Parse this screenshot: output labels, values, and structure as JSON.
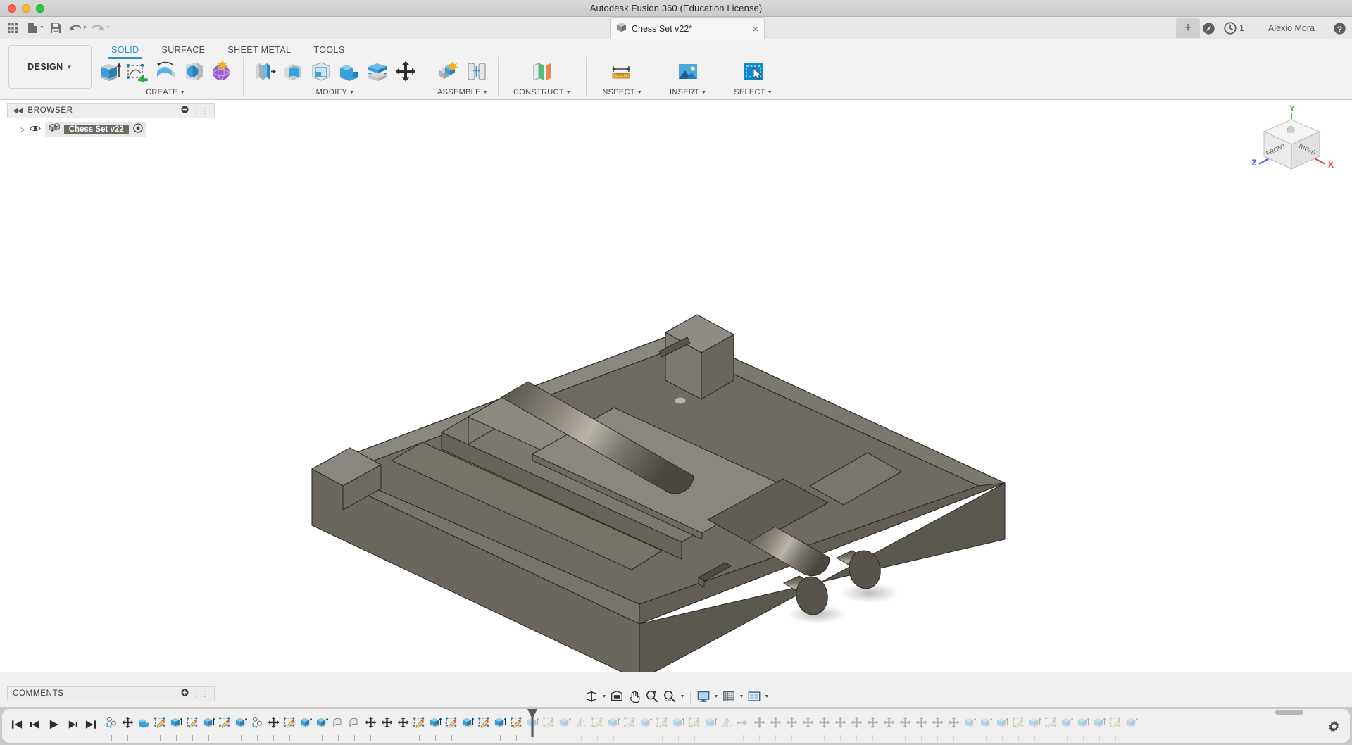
{
  "window": {
    "app_title": "Autodesk Fusion 360 (Education License)",
    "traffic_lights": [
      "close-red",
      "minimize-yellow",
      "maximize-green"
    ]
  },
  "quick_access": {
    "buttons": [
      {
        "name": "app-grid-icon",
        "label": "Show Data Panel"
      },
      {
        "name": "file-icon",
        "label": "File"
      },
      {
        "name": "save-icon",
        "label": "Save"
      },
      {
        "name": "undo-icon",
        "label": "Undo"
      },
      {
        "name": "redo-icon",
        "label": "Redo"
      }
    ]
  },
  "document_tab": {
    "title": "Chess Set v22*",
    "icon": "cube-icon",
    "close_label": "×"
  },
  "new_tab_label": "+",
  "account": {
    "notification_icon": "compass-icon",
    "job_status_icon": "clock-icon",
    "job_count": "1",
    "user_name": "Alexio Mora",
    "help_icon": "help-icon"
  },
  "ribbon": {
    "design_dropdown": "DESIGN",
    "workspace_tabs": [
      {
        "label": "SOLID",
        "active": true
      },
      {
        "label": "SURFACE",
        "active": false
      },
      {
        "label": "SHEET METAL",
        "active": false
      },
      {
        "label": "TOOLS",
        "active": false
      }
    ],
    "panels": [
      {
        "label": "CREATE",
        "has_caret": true,
        "tools": [
          "extrude-icon",
          "create-sketch-icon",
          "revolve-icon",
          "sweep-icon",
          "form-icon"
        ]
      },
      {
        "label": "MODIFY",
        "has_caret": true,
        "tools": [
          "press-pull-icon",
          "fillet-icon",
          "shell-icon",
          "combine-icon",
          "split-face-icon",
          "move-copy-icon"
        ]
      },
      {
        "label": "ASSEMBLE",
        "has_caret": true,
        "tools": [
          "new-component-icon",
          "joint-icon"
        ]
      },
      {
        "label": "CONSTRUCT",
        "has_caret": true,
        "tools": [
          "offset-plane-icon"
        ]
      },
      {
        "label": "INSPECT",
        "has_caret": true,
        "tools": [
          "measure-icon"
        ]
      },
      {
        "label": "INSERT",
        "has_caret": true,
        "tools": [
          "insert-image-icon"
        ]
      },
      {
        "label": "SELECT",
        "has_caret": true,
        "tools": [
          "select-window-icon"
        ]
      }
    ]
  },
  "browser": {
    "title": "BROWSER",
    "collapse_icon": "double-chevron-left-icon",
    "minimize_icon": "minus-circle-icon",
    "root": {
      "expand_icon": "triangle-right-icon",
      "visibility_icon": "eye-icon",
      "component_icon": "component-icon",
      "name": "Chess Set v22",
      "selected": true,
      "target_icon": "target-icon"
    }
  },
  "viewcube": {
    "front_label": "FRONT",
    "right_label": "RIGHT",
    "axes": [
      {
        "label": "X",
        "color": "#e8413c"
      },
      {
        "label": "Y",
        "color": "#36c13b"
      },
      {
        "label": "Z",
        "color": "#3b5de8"
      }
    ],
    "home_icon": "home-icon"
  },
  "comments": {
    "title": "COMMENTS",
    "add_icon": "plus-circle-icon"
  },
  "navigation_bar": {
    "items": [
      {
        "name": "orbit-icon",
        "caret": true
      },
      {
        "name": "look-at-icon",
        "caret": false
      },
      {
        "name": "pan-icon",
        "caret": false
      },
      {
        "name": "zoom-icon",
        "caret": false
      },
      {
        "name": "fit-icon",
        "caret": true
      },
      {
        "name": "display-settings-icon",
        "caret": true
      },
      {
        "name": "grid-snaps-icon",
        "caret": true
      },
      {
        "name": "viewports-icon",
        "caret": true
      }
    ]
  },
  "timeline": {
    "playback": [
      {
        "name": "go-to-beginning-button"
      },
      {
        "name": "step-back-button"
      },
      {
        "name": "play-button"
      },
      {
        "name": "step-forward-button"
      },
      {
        "name": "go-to-end-button"
      }
    ],
    "settings_icon": "gear-icon",
    "playhead_position_index": 25,
    "features": [
      "construction-point-icon",
      "move-icon",
      "combine-icon",
      "sketch-icon",
      "extrude-icon",
      "sketch-icon",
      "extrude-icon",
      "sketch-icon",
      "extrude-icon",
      "construction-point-icon",
      "move-icon",
      "sketch-icon",
      "extrude-icon",
      "extrude-icon",
      "fillet-icon",
      "fillet-icon",
      "move-icon",
      "move-icon",
      "move-icon",
      "sketch-icon",
      "extrude-icon",
      "sketch-icon",
      "extrude-icon",
      "sketch-icon",
      "extrude-icon",
      "sketch-icon",
      "extrude-icon",
      "sketch-icon",
      "extrude-icon",
      "mirror-icon",
      "sketch-icon",
      "extrude-icon",
      "sketch-icon",
      "extrude-icon",
      "sketch-icon",
      "extrude-icon",
      "sketch-icon",
      "extrude-icon",
      "mirror-icon",
      "revolve-icon",
      "move-icon",
      "move-icon",
      "move-icon",
      "move-icon",
      "move-icon",
      "move-icon",
      "move-icon",
      "move-icon",
      "move-icon",
      "move-icon",
      "move-icon",
      "move-icon",
      "move-icon",
      "extrude-icon",
      "extrude-icon",
      "extrude-icon",
      "sketch-icon",
      "extrude-icon",
      "sketch-icon",
      "extrude-icon",
      "extrude-icon",
      "extrude-icon",
      "sketch-icon",
      "extrude-icon"
    ]
  },
  "model": {
    "description": "Grey metallic chess set storage tray, isometric view",
    "body_color": "#6e6a62",
    "top_color": "#7d7a71",
    "side_color": "#565249",
    "background": "#ffffff"
  },
  "colors": {
    "accent": "#2a8fd0",
    "ribbon_bg": "#f2f2f2",
    "titlebar_bg": "#d4d4d4",
    "selection": "#6d6a63"
  }
}
